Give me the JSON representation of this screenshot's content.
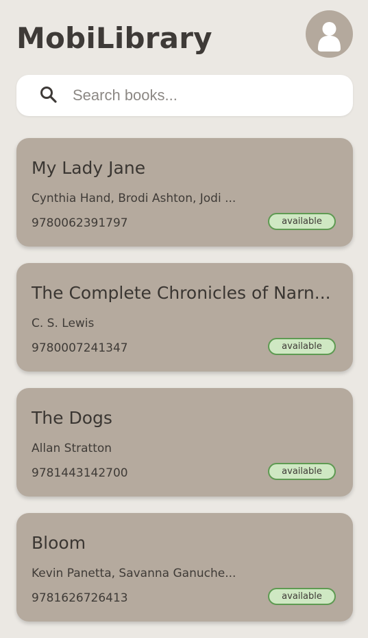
{
  "header": {
    "title": "MobiLibrary",
    "avatar_icon": "user-icon"
  },
  "search": {
    "icon": "search-icon",
    "placeholder": "Search books...",
    "value": ""
  },
  "books": [
    {
      "title": "My Lady Jane",
      "authors": "Cynthia Hand, Brodi Ashton, Jodi ...",
      "isbn": "9780062391797",
      "status": "available"
    },
    {
      "title": "The Complete Chronicles of Narn...",
      "authors": "C. S. Lewis",
      "isbn": "9780007241347",
      "status": "available"
    },
    {
      "title": "The Dogs",
      "authors": "Allan Stratton",
      "isbn": "9781443142700",
      "status": "available"
    },
    {
      "title": "Bloom",
      "authors": "Kevin Panetta, Savanna Ganuche...",
      "isbn": "9781626726413",
      "status": "available"
    }
  ],
  "colors": {
    "background": "#ebe8e3",
    "card": "#b5aa9e",
    "avatar": "#b4a99d",
    "badge_fill": "#cfe8c3",
    "badge_border": "#5e9a52"
  }
}
